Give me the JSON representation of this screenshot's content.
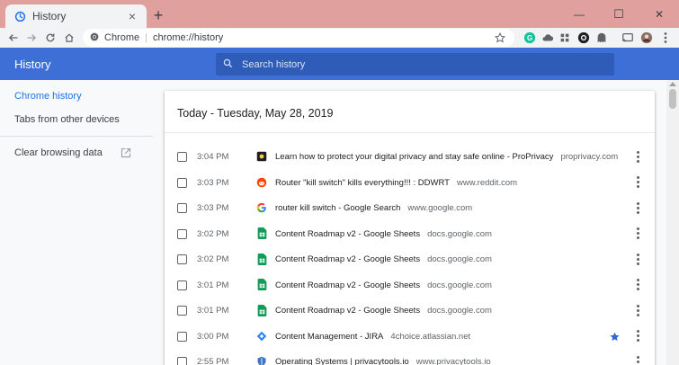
{
  "tab": {
    "title": "History",
    "close": "×",
    "new_tab": "+"
  },
  "window_controls": {
    "minimize": "—",
    "maximize": "☐",
    "close": "✕"
  },
  "omnibox": {
    "chip": "Chrome",
    "separator": "|",
    "url": "chrome://history"
  },
  "header": {
    "title": "History",
    "search_placeholder": "Search history"
  },
  "sidebar": {
    "items": [
      {
        "label": "Chrome history",
        "active": true
      },
      {
        "label": "Tabs from other devices",
        "active": false
      }
    ],
    "clear_label": "Clear browsing data"
  },
  "card": {
    "title": "Today - Tuesday, May 28, 2019",
    "rows": [
      {
        "time": "3:04 PM",
        "title": "Learn how to protect your digital privacy and stay safe online - ProPrivacy",
        "domain": "proprivacy.com",
        "favicon": "proprivacy-icon",
        "starred": false
      },
      {
        "time": "3:03 PM",
        "title": "Router \"kill switch\" kills everything!!! : DDWRT",
        "domain": "www.reddit.com",
        "favicon": "reddit-icon",
        "starred": false
      },
      {
        "time": "3:03 PM",
        "title": "router kill switch - Google Search",
        "domain": "www.google.com",
        "favicon": "google-icon",
        "starred": false
      },
      {
        "time": "3:02 PM",
        "title": "Content Roadmap v2 - Google Sheets",
        "domain": "docs.google.com",
        "favicon": "sheets-icon",
        "starred": false
      },
      {
        "time": "3:02 PM",
        "title": "Content Roadmap v2 - Google Sheets",
        "domain": "docs.google.com",
        "favicon": "sheets-icon",
        "starred": false
      },
      {
        "time": "3:01 PM",
        "title": "Content Roadmap v2 - Google Sheets",
        "domain": "docs.google.com",
        "favicon": "sheets-icon",
        "starred": false
      },
      {
        "time": "3:01 PM",
        "title": "Content Roadmap v2 - Google Sheets",
        "domain": "docs.google.com",
        "favicon": "sheets-icon",
        "starred": false
      },
      {
        "time": "3:00 PM",
        "title": "Content Management - JIRA",
        "domain": "4choice.atlassian.net",
        "favicon": "jira-icon",
        "starred": true
      },
      {
        "time": "2:55 PM",
        "title": "Operating Systems | privacytools.io",
        "domain": "www.privacytools.io",
        "favicon": "privacytools-icon",
        "starred": false
      }
    ]
  },
  "colors": {
    "header_blue": "#3e6fd6",
    "search_blue": "#2f5bb9",
    "tabstrip": "#e0a09e",
    "active_link": "#1a73e8",
    "star_blue": "#3367d6"
  }
}
